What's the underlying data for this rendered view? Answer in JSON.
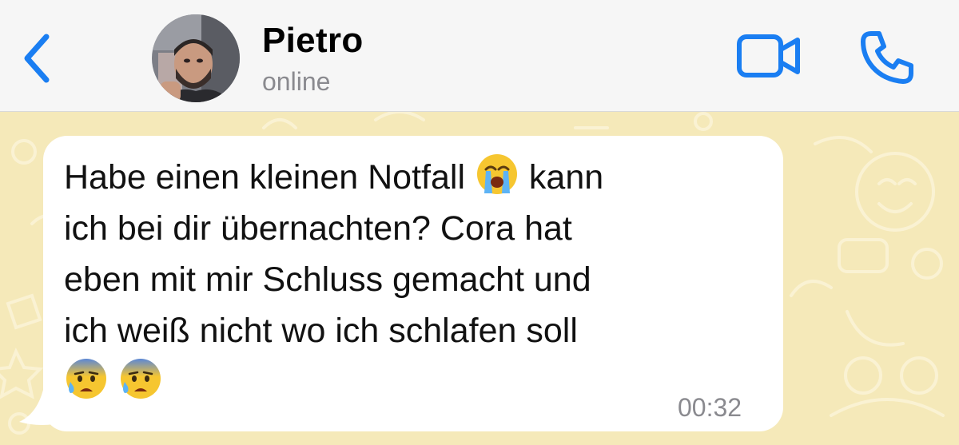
{
  "header": {
    "back_icon": "chevron-left-icon",
    "contact_name": "Pietro",
    "status": "online",
    "video_icon": "video-camera-icon",
    "call_icon": "phone-icon",
    "accent_color": "#1a7ef2"
  },
  "chat": {
    "background_color": "#f5e9b9",
    "message": {
      "segments": [
        {
          "text": "Habe einen kleinen Notfall "
        },
        {
          "emoji": "loudly-crying-face-icon"
        },
        {
          "text": " kann ich bei dir übernachten? Cora hat eben mit mir Schluss gemacht und ich weiß nicht wo ich schlafen soll "
        },
        {
          "emoji": "anxious-face-with-sweat-icon"
        },
        {
          "emoji": "anxious-face-with-sweat-icon"
        }
      ],
      "line1": "Habe einen kleinen Notfall",
      "line1b": "kann",
      "line2": "ich bei dir übernachten? Cora hat",
      "line3": "eben mit mir Schluss gemacht und",
      "line4": "ich weiß nicht wo ich schlafen soll",
      "time": "00:32"
    }
  }
}
